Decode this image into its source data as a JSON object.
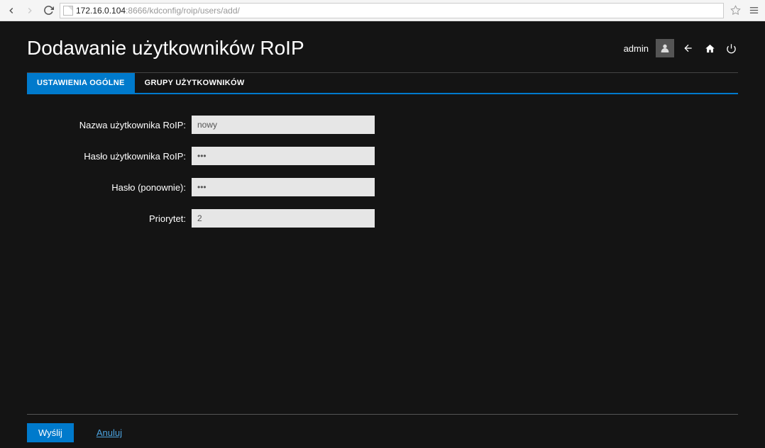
{
  "browser": {
    "url_host": "172.16.0.104",
    "url_port_path": ":8666/kdconfig/roip/users/add/"
  },
  "header": {
    "title": "Dodawanie użytkowników RoIP",
    "username": "admin"
  },
  "tabs": [
    {
      "label": "USTAWIENIA OGÓLNE",
      "active": true
    },
    {
      "label": "GRUPY UŻYTKOWNIKÓW",
      "active": false
    }
  ],
  "form": {
    "username": {
      "label": "Nazwa użytkownika RoIP:",
      "value": "nowy"
    },
    "password": {
      "label": "Hasło użytkownika RoIP:",
      "value": "aaa"
    },
    "password2": {
      "label": "Hasło (ponownie):",
      "value": "aaa"
    },
    "priority": {
      "label": "Priorytet:",
      "value": "2"
    }
  },
  "footer": {
    "submit": "Wyślij",
    "cancel": "Anuluj"
  }
}
